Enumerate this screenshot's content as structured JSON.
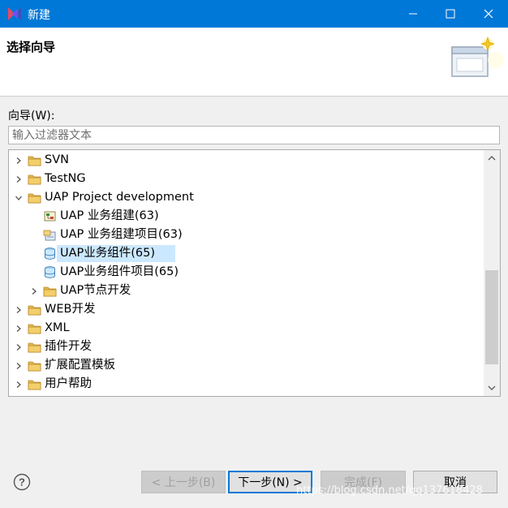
{
  "window": {
    "title": "新建"
  },
  "header": {
    "title": "选择向导"
  },
  "wizard_label": "向导(W):",
  "filter": {
    "placeholder": "输入过滤器文本",
    "value": ""
  },
  "tree": {
    "items": [
      {
        "label": "SVN",
        "expander": "collapsed",
        "icon": "folder-icon"
      },
      {
        "label": "TestNG",
        "expander": "collapsed",
        "icon": "folder-icon"
      },
      {
        "label": "UAP Project development",
        "expander": "expanded",
        "icon": "folder-icon"
      },
      {
        "label": "UAP 业务组建(63)",
        "expander": "none",
        "icon": "component-icon"
      },
      {
        "label": "UAP 业务组建项目(63)",
        "expander": "none",
        "icon": "project-icon"
      },
      {
        "label": "UAP业务组件(65)",
        "expander": "none",
        "icon": "database-icon",
        "selected": true
      },
      {
        "label": "UAP业务组件项目(65)",
        "expander": "none",
        "icon": "database-icon"
      },
      {
        "label": "UAP节点开发",
        "expander": "collapsed",
        "icon": "folder-icon"
      },
      {
        "label": "WEB开发",
        "expander": "collapsed",
        "icon": "folder-icon"
      },
      {
        "label": "XML",
        "expander": "collapsed",
        "icon": "folder-icon"
      },
      {
        "label": "插件开发",
        "expander": "collapsed",
        "icon": "folder-icon"
      },
      {
        "label": "扩展配置模板",
        "expander": "collapsed",
        "icon": "folder-icon"
      },
      {
        "label": "用户帮助",
        "expander": "collapsed",
        "icon": "folder-icon"
      }
    ]
  },
  "buttons": {
    "back": "< 上一步(B)",
    "next": "下一步(N) >",
    "finish": "完成(F)",
    "cancel": "取消"
  },
  "watermark": "https://blog.csdn.net/qq137618428",
  "colors": {
    "titlebar": "#0078d7",
    "selection": "#cce8ff",
    "folder": "#e8b84a"
  }
}
